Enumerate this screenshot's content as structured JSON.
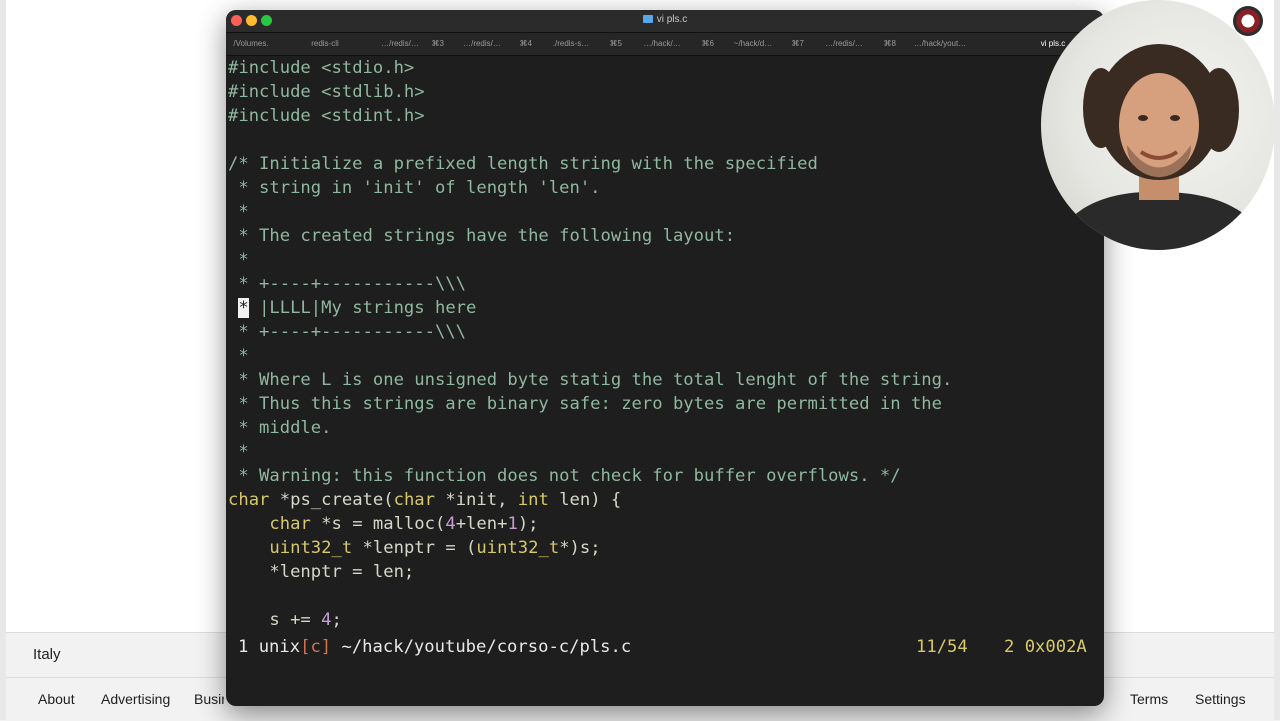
{
  "background_page": {
    "location": "Italy",
    "footer_links": {
      "about": "About",
      "advertising": "Advertising",
      "business": "Busin",
      "terms": "Terms",
      "settings": "Settings"
    }
  },
  "terminal": {
    "title": "vi pls.c",
    "tabs": [
      {
        "label": "/Volumes.",
        "shortcut": ""
      },
      {
        "label": "redis-cli",
        "shortcut": ""
      },
      {
        "label": "…/redis/…",
        "shortcut": "⌘3"
      },
      {
        "label": "…/redis/…",
        "shortcut": "⌘4"
      },
      {
        "label": "./redis-s…",
        "shortcut": "⌘5"
      },
      {
        "label": "…/hack/…",
        "shortcut": "⌘6"
      },
      {
        "label": "~/hack/d…",
        "shortcut": "⌘7"
      },
      {
        "label": "…/redis/…",
        "shortcut": "⌘8"
      },
      {
        "label": "…/hack/yout…",
        "shortcut": ""
      },
      {
        "label": "vi pls.c",
        "shortcut": ""
      }
    ],
    "code": {
      "l1_a": "#include",
      "l1_b": " <stdio.h>",
      "l2_a": "#include",
      "l2_b": " <stdlib.h>",
      "l3_a": "#include",
      "l3_b": " <stdint.h>",
      "l5": "/* Initialize a prefixed length string with the specified",
      "l6": " * string in 'init' of length 'len'.",
      "l7": " *",
      "l8": " * The created strings have the following layout:",
      "l9": " *",
      "l10": " * +----+-----------\\\\\\",
      "l11_cursor": "*",
      "l11_rest": " |LLLL|My strings here",
      "l12": " * +----+-----------\\\\\\",
      "l13": " *",
      "l14": " * Where L is one unsigned byte statig the total lenght of the string.",
      "l15": " * Thus this strings are binary safe: zero bytes are permitted in the",
      "l16": " * middle.",
      "l17": " *",
      "l18": " * Warning: this function does not check for buffer overflows. */",
      "l19_kw1": "char",
      "l19_a": " *ps_create(",
      "l19_kw2": "char",
      "l19_b": " *init, ",
      "l19_kw3": "int",
      "l19_c": " len) {",
      "l20_indent": "    ",
      "l20_kw": "char",
      "l20_a": " *s = malloc(",
      "l20_n1": "4",
      "l20_b": "+len+",
      "l20_n2": "1",
      "l20_c": ");",
      "l21_indent": "    ",
      "l21_kw1": "uint32_t",
      "l21_a": " *lenptr = (",
      "l21_kw2": "uint32_t",
      "l21_b": "*)s;",
      "l22": "    *lenptr = len;",
      "l24_a": "    s += ",
      "l24_n": "4",
      "l24_b": ";"
    },
    "statusline": {
      "left_a": "1 unix",
      "left_bracket": "[c]",
      "left_path": " ~/hack/youtube/corso-c/pls.c",
      "position": "11/54",
      "right": "2 0x002A"
    }
  }
}
